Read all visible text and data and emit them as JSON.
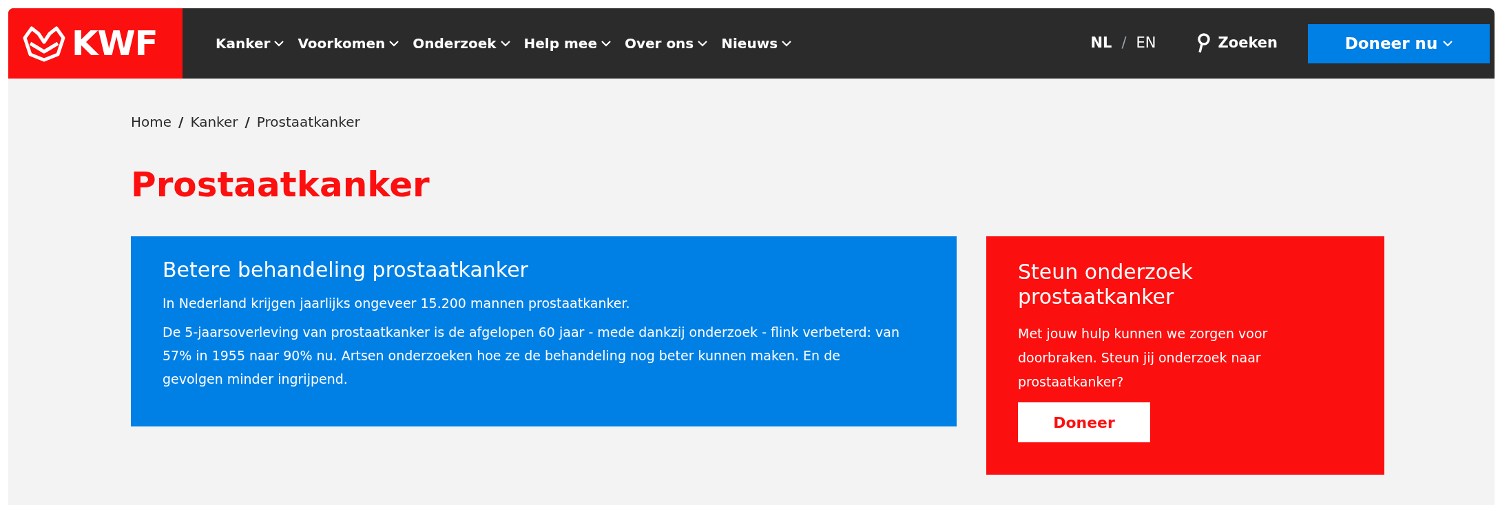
{
  "header": {
    "logo": "KWF",
    "nav": [
      {
        "label": "Kanker"
      },
      {
        "label": "Voorkomen"
      },
      {
        "label": "Onderzoek"
      },
      {
        "label": "Help mee"
      },
      {
        "label": "Over ons"
      },
      {
        "label": "Nieuws"
      }
    ],
    "languages": [
      {
        "label": "NL",
        "selected": true
      },
      {
        "label": "EN",
        "selected": false
      }
    ],
    "language_separator": "/",
    "search": "Zoeken",
    "donate_button": "Doneer nu"
  },
  "breadcrumb": {
    "items": [
      "Home",
      "Kanker",
      "Prostaatkanker"
    ],
    "separator": "/"
  },
  "title": "Prostaatkanker",
  "info_card": {
    "heading": "Betere behandeling prostaatkanker",
    "paragraphs": [
      "In Nederland krijgen jaarlijks ongeveer 15.200 mannen prostaatkanker.",
      "De 5-jaarsoverleving van prostaatkanker is de afgelopen 60 jaar - mede dankzij onderzoek - flink verbeterd: van 57% in 1955 naar 90% nu. Artsen onderzoeken hoe ze de behandeling nog beter kunnen maken. En de gevolgen minder ingrijpend."
    ]
  },
  "donate_card": {
    "heading": "Steun onderzoek prostaatkanker",
    "text": "Met jouw hulp kunnen we zorgen voor doorbraken. Steun jij onderzoek naar prostaatkanker?",
    "button": "Doneer"
  }
}
